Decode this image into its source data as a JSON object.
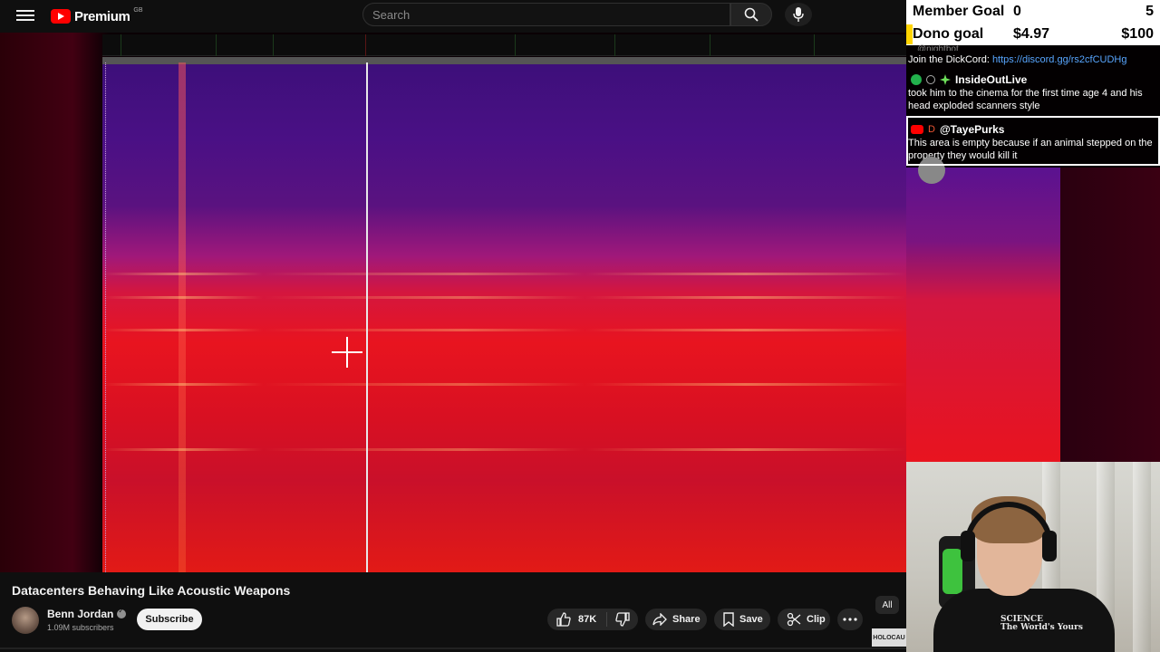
{
  "header": {
    "brand": "Premium",
    "region": "GB",
    "search_placeholder": "Search"
  },
  "overlay": {
    "goals": [
      {
        "label": "Member Goal",
        "current": "0",
        "target": "5"
      },
      {
        "label": "Dono goal",
        "current": "$4.97",
        "target": "$100"
      }
    ],
    "chat": {
      "previous_fragment": "@nightbot",
      "link_line_prefix": "Join the DickCord: ",
      "link_line_url": "https://discord.gg/rs2cfCUDHg",
      "messages": [
        {
          "user": "InsideOutLive",
          "text": "took him to the cinema for the first time age 4 and his head exploded scanners style"
        },
        {
          "user": "@TayePurks",
          "text": "This area is empty because if an animal stepped on the property they would kill it"
        }
      ]
    },
    "webcam_shirt_text": "SCIENCE\nThe World's Yours"
  },
  "video": {
    "title": "Datacenters Behaving Like Acoustic Weapons",
    "channel": "Benn Jordan",
    "subscribers": "1.09M subscribers",
    "subscribe_label": "Subscribe",
    "likes": "87K",
    "share_label": "Share",
    "save_label": "Save",
    "clip_label": "Clip",
    "filter_chip": "All",
    "thumb_label": "HOLOCAU"
  },
  "colors": {
    "accent": "#ff0000",
    "goal_fill": "#ffd400",
    "link": "#58a6ff"
  }
}
